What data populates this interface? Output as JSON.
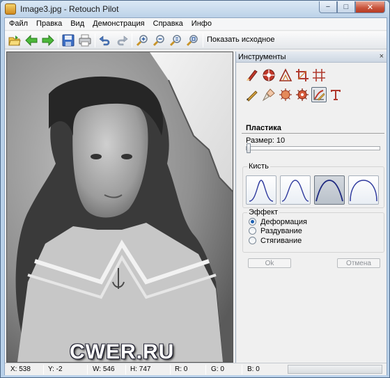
{
  "window": {
    "title": "Image3.jpg - Retouch Pilot",
    "min_label": "−",
    "max_label": "□",
    "close_label": "✕"
  },
  "menu": [
    "Файл",
    "Правка",
    "Вид",
    "Демонстрация",
    "Справка",
    "Инфо"
  ],
  "toolbar": {
    "buttons": [
      "open-icon",
      "back-arrow-icon",
      "forward-arrow-icon",
      "save-icon",
      "print-icon",
      "undo-icon",
      "redo-icon",
      "zoom-in-icon",
      "zoom-out-icon",
      "zoom-fit-icon",
      "zoom-actual-icon"
    ],
    "show_original": "Показать исходное"
  },
  "canvas": {
    "watermark": "CWER.RU"
  },
  "panel": {
    "title": "Инструменты",
    "close": "×",
    "tools_row1": [
      "clone-brush-icon",
      "patch-icon",
      "triangle-measure-icon",
      "crop-icon",
      "grid-icon"
    ],
    "tools_row2": [
      "pencil-icon",
      "brush-icon",
      "scratch-filter-icon",
      "dust-filter-icon",
      "liquify-icon",
      "text-icon"
    ],
    "active_tool": "liquify-icon",
    "section": "Пластика",
    "size_label": "Размер: 10",
    "size_value": 10,
    "brush_group": "Кисть",
    "brushes": [
      "narrow",
      "medium",
      "wide",
      "flat"
    ],
    "active_brush": 2,
    "effect_group": "Эффект",
    "effects": [
      "Деформация",
      "Раздувание",
      "Стягивание"
    ],
    "selected_effect": 0,
    "ok": "Ok",
    "cancel": "Отмена"
  },
  "status": {
    "x": "X: 538",
    "y": "Y: -2",
    "w": "W: 546",
    "h": "H: 747",
    "r": "R: 0",
    "g": "G: 0",
    "b": "B: 0"
  }
}
